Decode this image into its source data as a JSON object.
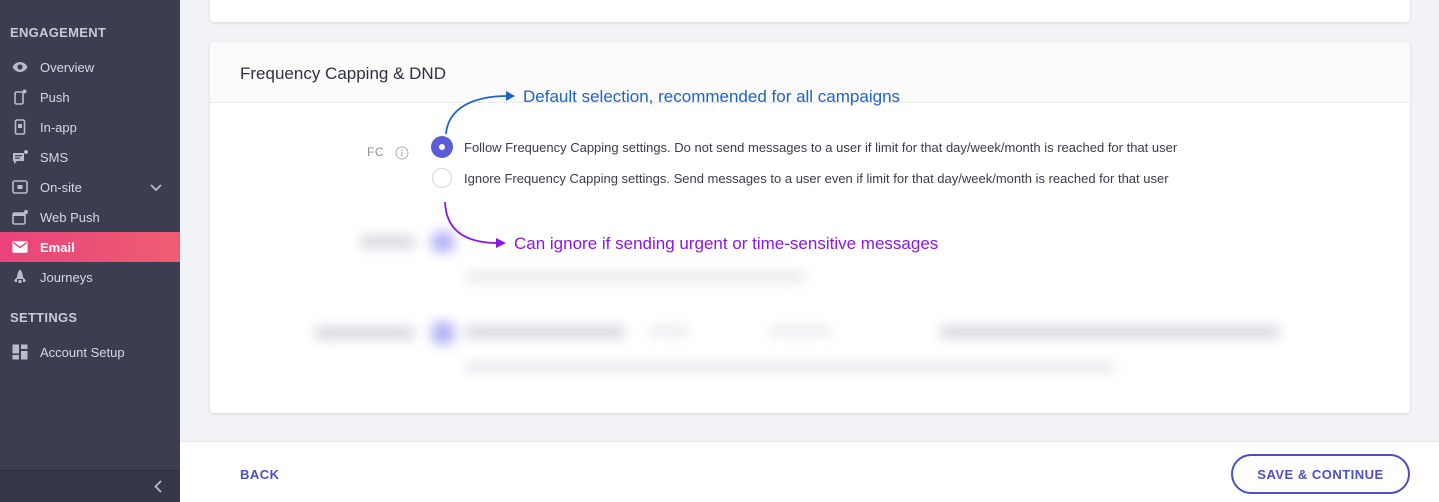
{
  "sidebar": {
    "engagement_title": "ENGAGEMENT",
    "settings_title": "SETTINGS",
    "items": [
      {
        "label": "Overview",
        "icon": "eye-icon"
      },
      {
        "label": "Push",
        "icon": "mobile-push-icon"
      },
      {
        "label": "In-app",
        "icon": "in-app-icon"
      },
      {
        "label": "SMS",
        "icon": "sms-icon"
      },
      {
        "label": "On-site",
        "icon": "on-site-icon"
      },
      {
        "label": "Web Push",
        "icon": "web-push-icon"
      },
      {
        "label": "Email",
        "icon": "mail-icon",
        "active": true
      },
      {
        "label": "Journeys",
        "icon": "rocket-icon"
      }
    ],
    "settings_items": [
      {
        "label": "Account Setup",
        "icon": "grid-icon"
      }
    ]
  },
  "card": {
    "title": "Frequency Capping & DND",
    "fc_label": "FC",
    "options": [
      {
        "label": "Follow Frequency Capping settings. Do not send messages to a user if limit for that day/week/month is reached for that user",
        "selected": true
      },
      {
        "label": "Ignore Frequency Capping settings. Send messages to a user even if limit for that day/week/month is reached for that user",
        "selected": false
      }
    ]
  },
  "annotations": {
    "top": "Default selection, recommended for all campaigns",
    "bottom": "Can ignore if sending urgent or time-sensitive messages"
  },
  "footer": {
    "back_label": "BACK",
    "save_label": "SAVE & CONTINUE"
  },
  "colors": {
    "sidebar_bg": "#3b3e51",
    "active_gradient_start": "#e8437b",
    "active_gradient_end": "#ef5d71",
    "primary": "#4b4fc0",
    "radio_selected": "#5c5cd6",
    "annotation_blue": "#1e63c8",
    "annotation_purple": "#8a17e6"
  }
}
